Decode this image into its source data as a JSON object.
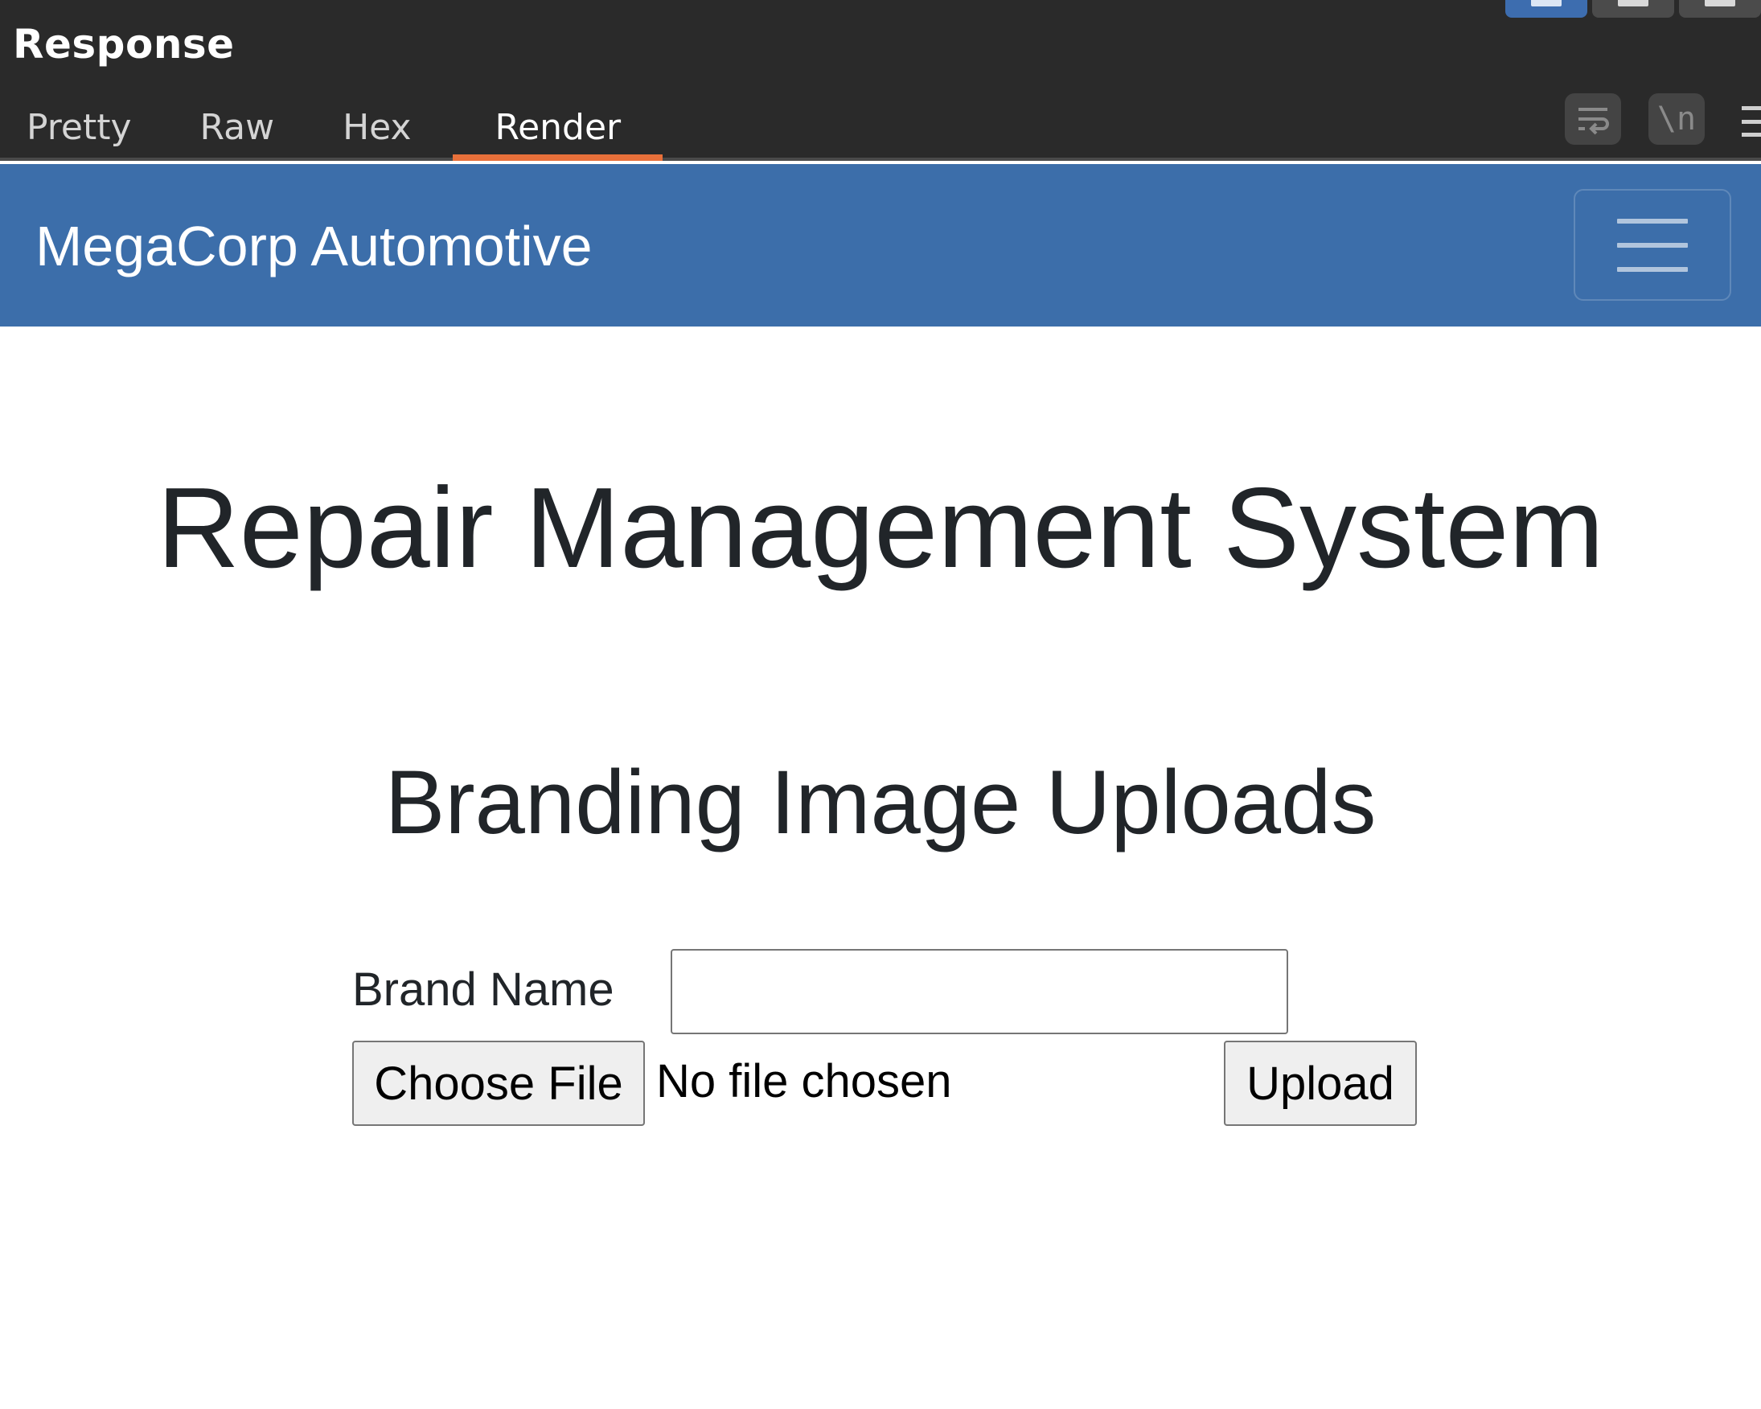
{
  "response_panel": {
    "title": "Response",
    "tabs": [
      {
        "label": "Pretty",
        "active": false
      },
      {
        "label": "Raw",
        "active": false
      },
      {
        "label": "Hex",
        "active": false
      },
      {
        "label": "Render",
        "active": true
      }
    ],
    "icons": {
      "wrap": "wrap-lines-icon",
      "newline": "\\n",
      "menu": "hamburger-menu-icon"
    },
    "accent_color": "#e8703a"
  },
  "page": {
    "navbar": {
      "brand": "MegaCorp Automotive",
      "background": "#3c6eaa",
      "toggler_icon": "hamburger-menu-icon"
    },
    "title": "Repair Management System",
    "section_title": "Branding Image Uploads",
    "form": {
      "brand_label": "Brand Name",
      "brand_value": "",
      "choose_file_label": "Choose File",
      "file_status": "No file chosen",
      "upload_label": "Upload"
    }
  }
}
